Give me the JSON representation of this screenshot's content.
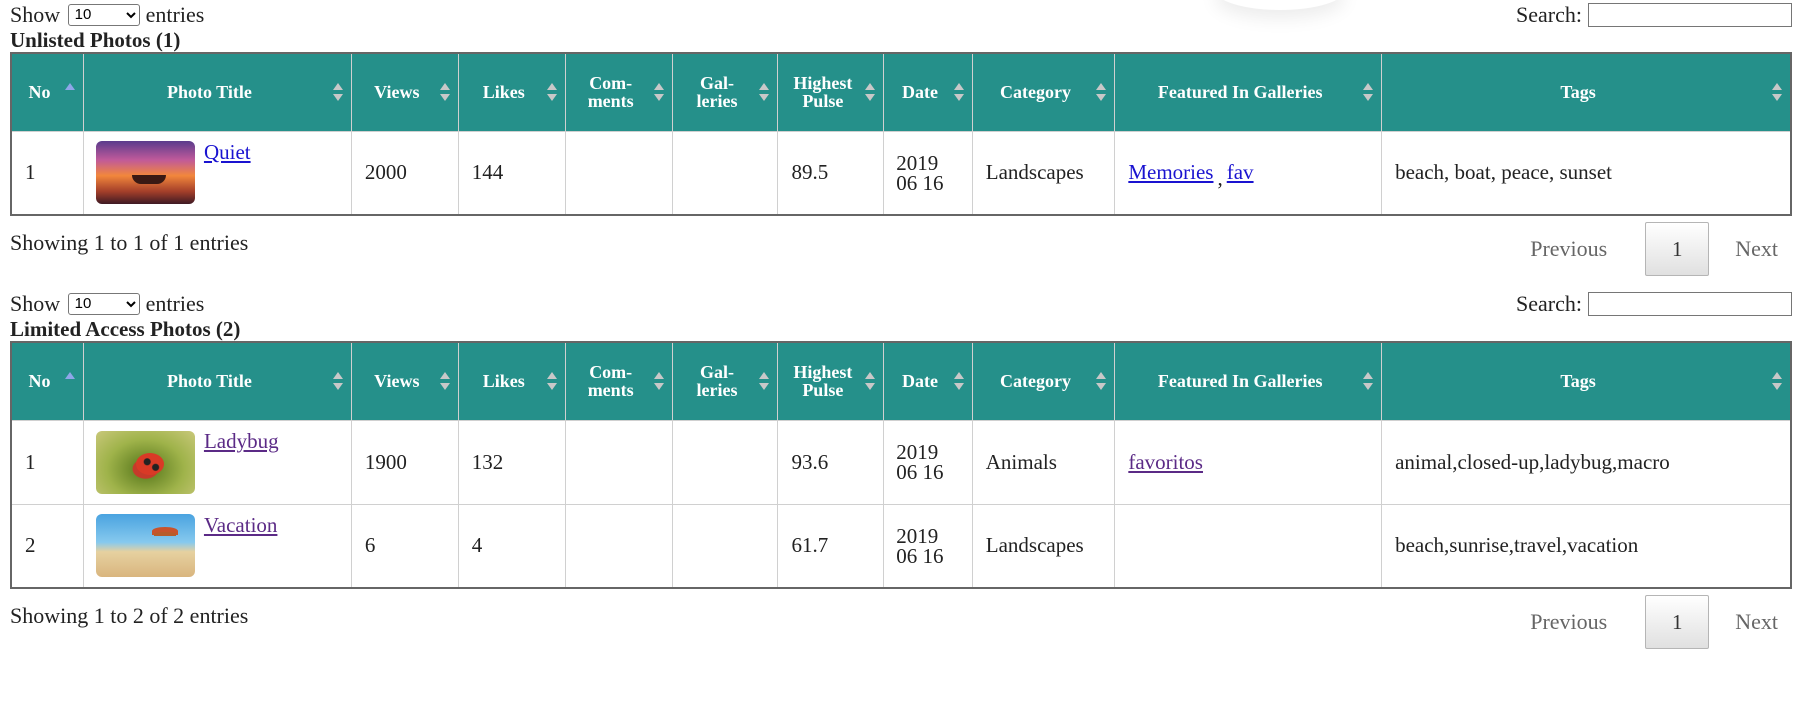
{
  "sections": [
    {
      "show_label": "Show",
      "entries_label": "entries",
      "page_length": "10",
      "search_label": "Search:",
      "title": "Unlisted Photos (1)",
      "columns": [
        "No",
        "Photo Title",
        "Views",
        "Likes",
        "Com-\nments",
        "Gal-\nleries",
        "Highest\nPulse",
        "Date",
        "Category",
        "Featured In Galleries",
        "Tags"
      ],
      "rows": [
        {
          "no": "1",
          "title": "Quiet",
          "thumb": "sunset",
          "views": "2000",
          "likes": "144",
          "comments": "",
          "galleries": "",
          "pulse": "89.5",
          "date_year": "2019",
          "date_md": "06 16",
          "category": "Landscapes",
          "featured": [
            "Memories",
            "fav"
          ],
          "tags": "beach, boat, peace, sunset"
        }
      ],
      "info": "Showing 1 to 1 of 1 entries",
      "pager": {
        "previous": "Previous",
        "page": "1",
        "next": "Next"
      }
    },
    {
      "show_label": "Show",
      "entries_label": "entries",
      "page_length": "10",
      "search_label": "Search:",
      "title": "Limited Access Photos (2)",
      "columns": [
        "No",
        "Photo Title",
        "Views",
        "Likes",
        "Com-\nments",
        "Gal-\nleries",
        "Highest\nPulse",
        "Date",
        "Category",
        "Featured In Galleries",
        "Tags"
      ],
      "rows": [
        {
          "no": "1",
          "title": "Ladybug",
          "thumb": "ladybug",
          "views": "1900",
          "likes": "132",
          "comments": "",
          "galleries": "",
          "pulse": "93.6",
          "date_year": "2019",
          "date_md": "06 16",
          "category": "Animals",
          "featured": [
            "favoritos"
          ],
          "tags": "animal,closed-up,ladybug,macro"
        },
        {
          "no": "2",
          "title": "Vacation",
          "thumb": "vacation",
          "views": "6",
          "likes": "4",
          "comments": "",
          "galleries": "",
          "pulse": "61.7",
          "date_year": "2019",
          "date_md": "06 16",
          "category": "Landscapes",
          "featured": [],
          "tags": "beach,sunrise,travel,vacation"
        }
      ],
      "info": "Showing 1 to 2 of 2 entries",
      "pager": {
        "previous": "Previous",
        "page": "1",
        "next": "Next"
      }
    }
  ],
  "colors": {
    "header_bg": "#25908a",
    "link": "#1a13d0",
    "visited_link": "#5b2a86"
  }
}
